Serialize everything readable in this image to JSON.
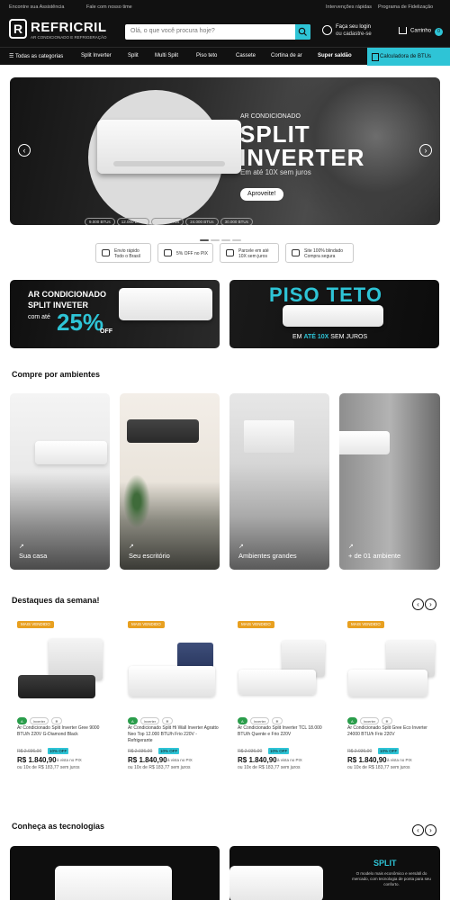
{
  "topbar": {
    "left_1": "Encontre sua Assistência",
    "left_2": "Fale com nosso time",
    "right_1": "Intervenções rápidas",
    "right_2": "Programa de Fidelização"
  },
  "header": {
    "logo_name": "REFRICRIL",
    "logo_tagline": "AR CONDICIONADO E REFRIGERAÇÃO",
    "search_placeholder": "Olá, o que você procura hoje?",
    "login_line1": "Faça seu login",
    "login_line2": "ou cadastre-se",
    "cart_label": "Carrinho",
    "cart_count": "0"
  },
  "nav": {
    "items": [
      "Todas as categorias",
      "Split Inverter",
      "Split",
      "Multi Split",
      "Piso teto",
      "Cassete",
      "Cortina de ar",
      "Super saldão"
    ],
    "cta": "Calculadora de BTUs"
  },
  "hero": {
    "kicker": "AR CONDICIONADO",
    "title_1": "SPLIT",
    "title_2": "INVERTER",
    "subtitle": "Em até 10X sem juros",
    "cta": "Aproveite!",
    "chips": [
      "9.000 BTUs",
      "12.000 BTUs",
      "18.000 BTUs",
      "24.000 BTUs",
      "30.000 BTUs"
    ],
    "prev": "‹",
    "next": "›"
  },
  "benefits": [
    {
      "text_1": "Envio rápido",
      "text_2": "Todo o Brasil"
    },
    {
      "text_1": "5% OFF no PIX",
      "text_2": ""
    },
    {
      "text_1": "Parcele em até",
      "text_2": "10X sem juros"
    },
    {
      "text_1": "Site 100% blindado",
      "text_2": "Compra segura"
    }
  ],
  "promo_1": {
    "line_1": "AR CONDICIONADO",
    "line_2": "SPLIT INVETER",
    "com_ate": "com até",
    "percent": "25%",
    "off": "OFF"
  },
  "promo_2": {
    "title": "PISO TETO",
    "prefix": "EM ",
    "highlight": "ATÉ 10X",
    "suffix": " SEM JUROS"
  },
  "sections": {
    "environments": "Compre por ambientes",
    "highlights": "Destaques da semana!",
    "technologies": "Conheça as tecnologias",
    "prev": "‹",
    "next": "›"
  },
  "environments": [
    {
      "label": "Sua casa"
    },
    {
      "label": "Seu escritório"
    },
    {
      "label": "Ambientes grandes"
    },
    {
      "label": "+ de 01 ambiente"
    }
  ],
  "products": [
    {
      "badge": "MAIS VENDIDO",
      "tags": [
        "A",
        "Inverter",
        ""
      ],
      "name": "Ar Condicionado Split Inverter Gree 9000 BTU/h 220V G-Diamond Black",
      "old_price": "R$ 2.036,00",
      "discount": "10% OFF",
      "price": "R$ 1.840,90",
      "pix": "à vista no PIX",
      "installments": "ou 10x de R$ 183,77 sem juros"
    },
    {
      "badge": "MAIS VENDIDO",
      "tags": [
        "A",
        "Inverter",
        ""
      ],
      "name": "Ar Condicionado Split Hi Wall Inverter Agratto Neo Top 12.000 BTU/h Frio 220V - Refrigerante",
      "old_price": "R$ 2.036,00",
      "discount": "10% OFF",
      "price": "R$ 1.840,90",
      "pix": "à vista no PIX",
      "installments": "ou 10x de R$ 183,77 sem juros"
    },
    {
      "badge": "MAIS VENDIDO",
      "tags": [
        "A",
        "Inverter",
        ""
      ],
      "name": "Ar Condicionado Split Inverter TCL 18.000 BTU/h Quente e Frio 220V",
      "old_price": "R$ 2.036,00",
      "discount": "10% OFF",
      "price": "R$ 1.840,90",
      "pix": "à vista no PIX",
      "installments": "ou 10x de R$ 183,77 sem juros"
    },
    {
      "badge": "MAIS VENDIDO",
      "tags": [
        "A",
        "Inverter",
        ""
      ],
      "name": "Ar Condicionado Split Gree Eco Inverter 24000 BTU/h Frio 220V",
      "old_price": "R$ 2.036,00",
      "discount": "10% OFF",
      "price": "R$ 1.840,90",
      "pix": "à vista no PIX",
      "installments": "ou 10x de R$ 183,77 sem juros"
    }
  ],
  "tech": {
    "right_title": "SPLIT",
    "right_text": "O modelo mais econômico e versátil do mercado, com tecnologia de ponta para seu conforto."
  },
  "colors": {
    "accent": "#2ec4d6",
    "header_bg": "#111111",
    "badge": "#e8a020"
  }
}
